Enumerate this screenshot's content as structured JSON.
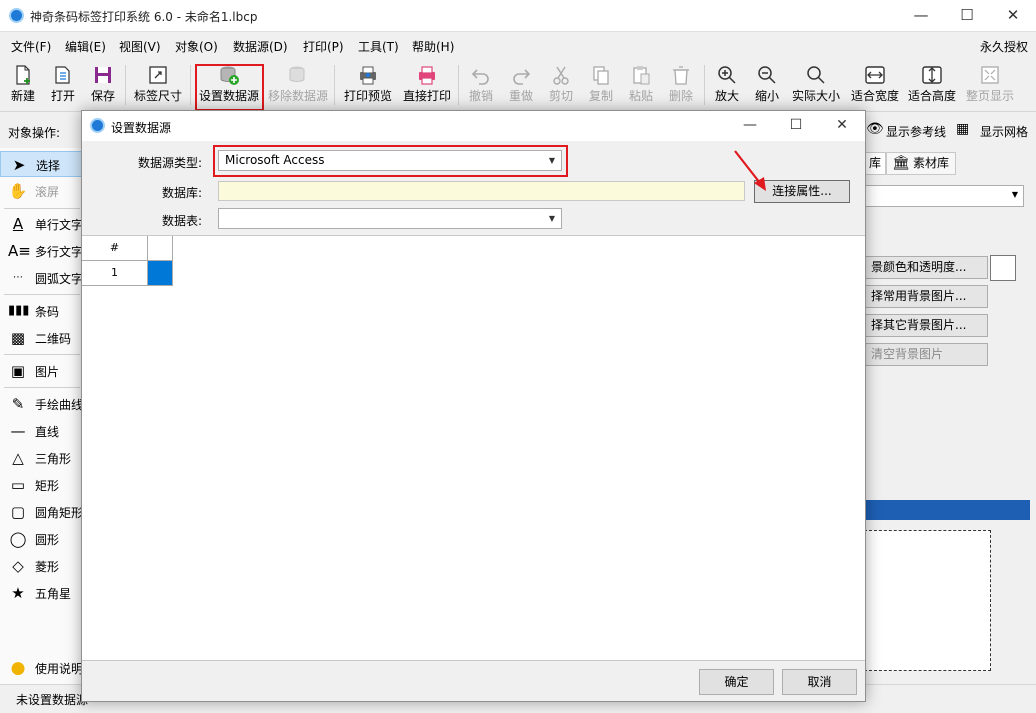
{
  "window": {
    "title": "神奇条码标签打印系统 6.0 - 未命名1.lbcp"
  },
  "menu": [
    "文件(F)",
    "编辑(E)",
    "视图(V)",
    "对象(O)",
    "数据源(D)",
    "打印(P)",
    "工具(T)",
    "帮助(H)"
  ],
  "license_label": "永久授权",
  "toolbar": {
    "new": "新建",
    "open": "打开",
    "save": "保存",
    "label_size": "标签尺寸",
    "set_datasource": "设置数据源",
    "remove_datasource": "移除数据源",
    "print_preview": "打印预览",
    "direct_print": "直接打印",
    "undo": "撤销",
    "redo": "重做",
    "cut": "剪切",
    "copy": "复制",
    "paste": "粘贴",
    "delete": "删除",
    "zoom_in": "放大",
    "zoom_out": "缩小",
    "actual_size": "实际大小",
    "fit_width": "适合宽度",
    "fit_height": "适合高度",
    "full_page": "整页显示"
  },
  "objbar": {
    "label": "对象操作:",
    "show_guides": "显示参考线",
    "show_grid": "显示网格"
  },
  "tools": {
    "select": "选择",
    "pan": "滚屏",
    "single_text": "单行文字",
    "multi_text": "多行文字",
    "arc_text": "圆弧文字",
    "barcode": "条码",
    "qrcode": "二维码",
    "image": "图片",
    "freehand": "手绘曲线",
    "line": "直线",
    "triangle": "三角形",
    "rectangle": "矩形",
    "rounded_rect": "圆角矩形",
    "ellipse": "圆形",
    "diamond": "菱形",
    "star": "五角星",
    "help": "使用说明"
  },
  "right_panel": {
    "tab1": "库",
    "tab2": "素材库",
    "btn_bg_color": "景颜色和透明度...",
    "btn_common_bg": "择常用背景图片...",
    "btn_other_bg": "择其它背景图片...",
    "btn_clear_bg": "清空背景图片"
  },
  "status": {
    "datasource": "未设置数据源"
  },
  "dialog": {
    "title": "设置数据源",
    "type_label": "数据源类型:",
    "type_value": "Microsoft Access",
    "db_label": "数据库:",
    "db_value": "",
    "table_label": "数据表:",
    "table_value": "",
    "connect_button": "连接属性...",
    "grid_header": "#",
    "grid_row": "1",
    "ok": "确定",
    "cancel": "取消"
  },
  "colors": {
    "accent": "#1e7ad6",
    "highlight": "#e0191e",
    "db_field": "#fbfbdb",
    "selected_cell": "#0078d7"
  }
}
